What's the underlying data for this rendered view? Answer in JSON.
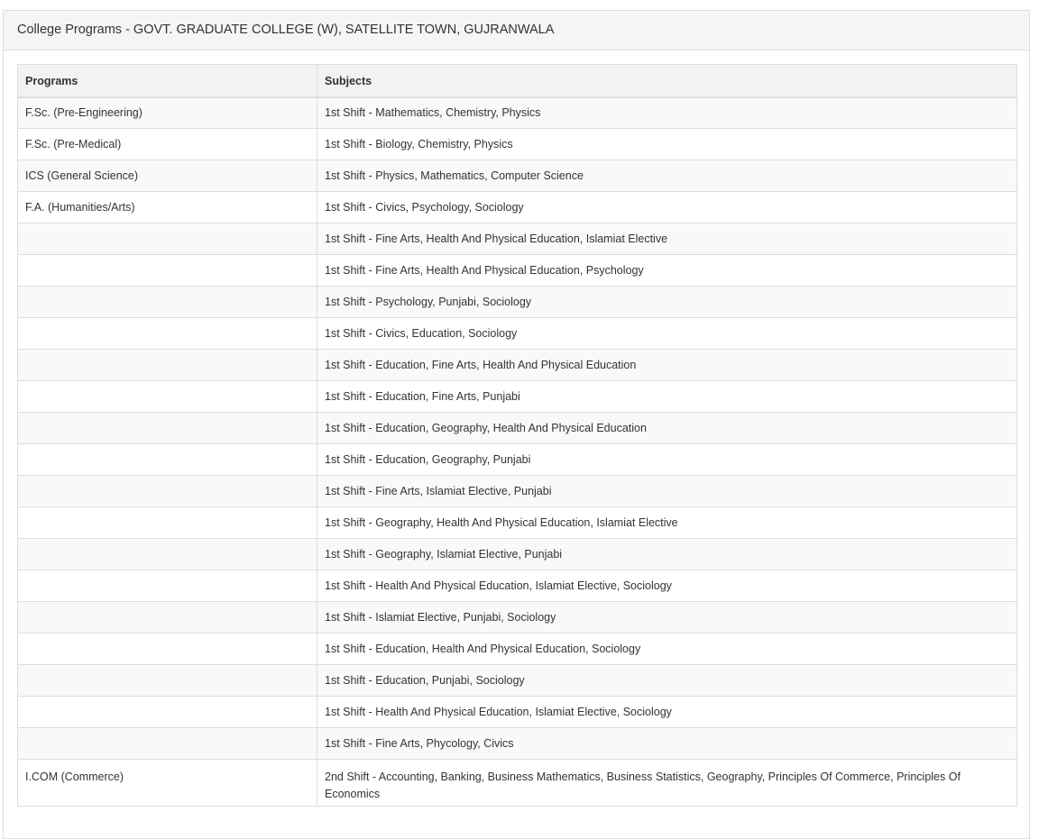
{
  "panel": {
    "title": "College Programs - GOVT. GRADUATE COLLEGE (W), SATELLITE TOWN, GUJRANWALA"
  },
  "table": {
    "headers": [
      "Programs",
      "Subjects"
    ],
    "rows": [
      {
        "program": "F.Sc. (Pre-Engineering)",
        "subjects": "1st Shift - Mathematics, Chemistry, Physics"
      },
      {
        "program": "F.Sc. (Pre-Medical)",
        "subjects": "1st Shift - Biology, Chemistry, Physics"
      },
      {
        "program": "ICS (General Science)",
        "subjects": "1st Shift - Physics, Mathematics, Computer Science"
      },
      {
        "program": "F.A. (Humanities/Arts)",
        "subjects": "1st Shift - Civics, Psychology, Sociology"
      },
      {
        "program": "",
        "subjects": "1st Shift - Fine Arts, Health And Physical Education, Islamiat Elective"
      },
      {
        "program": "",
        "subjects": "1st Shift - Fine Arts, Health And Physical Education, Psychology"
      },
      {
        "program": "",
        "subjects": "1st Shift - Psychology, Punjabi, Sociology"
      },
      {
        "program": "",
        "subjects": "1st Shift - Civics, Education, Sociology"
      },
      {
        "program": "",
        "subjects": "1st Shift - Education, Fine Arts, Health And Physical Education"
      },
      {
        "program": "",
        "subjects": "1st Shift - Education, Fine Arts, Punjabi"
      },
      {
        "program": "",
        "subjects": "1st Shift - Education, Geography, Health And Physical Education"
      },
      {
        "program": "",
        "subjects": "1st Shift - Education, Geography, Punjabi"
      },
      {
        "program": "",
        "subjects": "1st Shift - Fine Arts, Islamiat Elective, Punjabi"
      },
      {
        "program": "",
        "subjects": "1st Shift - Geography, Health And Physical Education, Islamiat Elective"
      },
      {
        "program": "",
        "subjects": "1st Shift - Geography, Islamiat Elective, Punjabi"
      },
      {
        "program": "",
        "subjects": "1st Shift - Health And Physical Education, Islamiat Elective, Sociology"
      },
      {
        "program": "",
        "subjects": "1st Shift - Islamiat Elective, Punjabi, Sociology"
      },
      {
        "program": "",
        "subjects": "1st Shift - Education, Health And Physical Education, Sociology"
      },
      {
        "program": "",
        "subjects": "1st Shift - Education, Punjabi, Sociology"
      },
      {
        "program": "",
        "subjects": "1st Shift - Health And Physical Education, Islamiat Elective, Sociology"
      },
      {
        "program": "",
        "subjects": "1st Shift - Fine Arts, Phycology, Civics"
      },
      {
        "program": "I.COM (Commerce)",
        "subjects": "2nd Shift - Accounting, Banking, Business Mathematics, Business Statistics, Geography, Principles Of Commerce, Principles Of Economics"
      }
    ]
  }
}
